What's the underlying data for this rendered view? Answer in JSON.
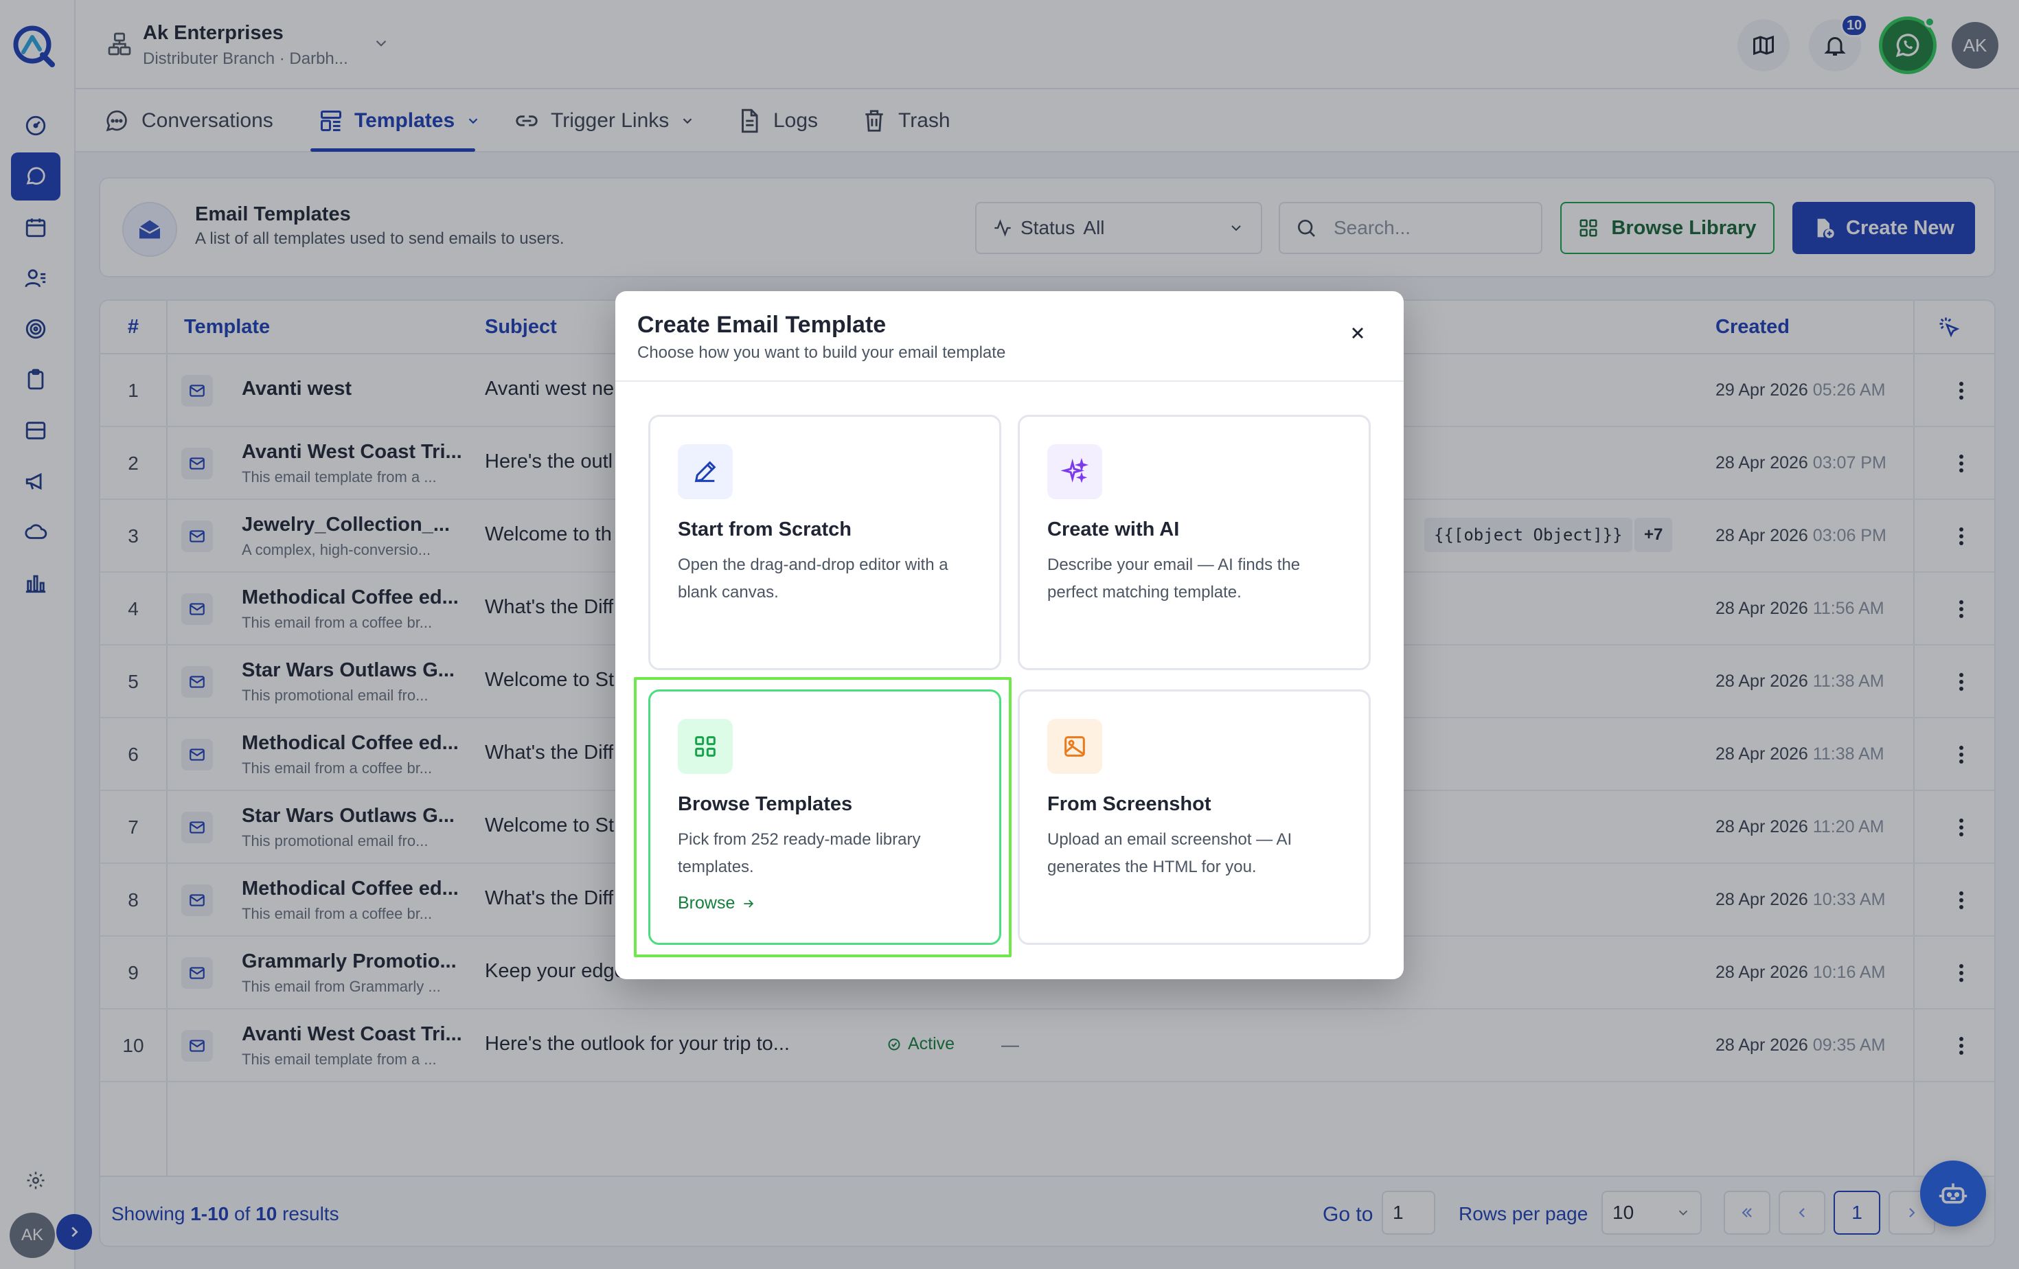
{
  "header": {
    "org_name": "Ak Enterprises",
    "org_sub": "Distributer Branch · Darbh...",
    "notif_count": "10",
    "avatar": "AK"
  },
  "sidebar": {
    "items": [
      "dashboard-icon",
      "chat-icon",
      "calendar-icon",
      "contacts-icon",
      "target-icon",
      "clipboard-icon",
      "inbox-icon",
      "megaphone-icon",
      "cloud-icon",
      "analytics-icon"
    ],
    "avatar": "AK"
  },
  "tabs": [
    {
      "label": "Conversations"
    },
    {
      "label": "Templates"
    },
    {
      "label": "Trigger Links"
    },
    {
      "label": "Logs"
    },
    {
      "label": "Trash"
    }
  ],
  "page": {
    "title": "Email Templates",
    "subtitle": "A list of all templates used to send emails to users.",
    "status_label": "Status",
    "status_value": "All",
    "search_placeholder": "Search...",
    "browse_library": "Browse Library",
    "create_new": "Create New"
  },
  "table": {
    "headers": {
      "num": "#",
      "template": "Template",
      "subject": "Subject",
      "created": "Created"
    },
    "rows": [
      {
        "num": "1",
        "name": "Avanti west",
        "desc": "",
        "subject": "Avanti west ne",
        "date": "29 Apr 2026",
        "time": "05:26 AM"
      },
      {
        "num": "2",
        "name": "Avanti West Coast Tri...",
        "desc": "This email template from a ...",
        "subject": "Here's the outl",
        "date": "28 Apr 2026",
        "time": "03:07 PM"
      },
      {
        "num": "3",
        "name": "Jewelry_Collection_...",
        "desc": "A complex, high-conversio...",
        "subject": "Welcome to th",
        "date": "28 Apr 2026",
        "time": "03:06 PM"
      },
      {
        "num": "4",
        "name": "Methodical Coffee ed...",
        "desc": "This email from a coffee br...",
        "subject": "What's the Diff",
        "date": "28 Apr 2026",
        "time": "11:56 AM"
      },
      {
        "num": "5",
        "name": "Star Wars Outlaws G...",
        "desc": "This promotional email fro...",
        "subject": "Welcome to St",
        "date": "28 Apr 2026",
        "time": "11:38 AM"
      },
      {
        "num": "6",
        "name": "Methodical Coffee ed...",
        "desc": "This email from a coffee br...",
        "subject": "What's the Diff",
        "date": "28 Apr 2026",
        "time": "11:38 AM"
      },
      {
        "num": "7",
        "name": "Star Wars Outlaws G...",
        "desc": "This promotional email fro...",
        "subject": "Welcome to St",
        "date": "28 Apr 2026",
        "time": "11:20 AM"
      },
      {
        "num": "8",
        "name": "Methodical Coffee ed...",
        "desc": "This email from a coffee br...",
        "subject": "What's the Diff",
        "date": "28 Apr 2026",
        "time": "10:33 AM"
      },
      {
        "num": "9",
        "name": "Grammarly Promotio...",
        "desc": "This email from Grammarly ...",
        "subject": "Keep your edge",
        "date": "28 Apr 2026",
        "time": "10:16 AM"
      },
      {
        "num": "10",
        "name": "Avanti West Coast Tri...",
        "desc": "This email template from a ...",
        "subject": "Here's the outlook for your trip to...",
        "date": "28 Apr 2026",
        "time": "09:35 AM",
        "status": "Active",
        "vars": "—"
      }
    ],
    "row3_var_chip": "{{[object Object]}}",
    "row3_more": "+7"
  },
  "footer": {
    "showing_prefix": "Showing",
    "showing_range": "1-10",
    "showing_of": "of",
    "showing_total": "10",
    "showing_suffix": "results",
    "goto_label": "Go to",
    "goto_value": "1",
    "rows_label": "Rows per page",
    "rows_value": "10",
    "current_page": "1"
  },
  "modal": {
    "title": "Create Email Template",
    "subtitle": "Choose how you want to build your email template",
    "options": [
      {
        "title": "Start from Scratch",
        "desc": "Open the drag-and-drop editor with a blank canvas."
      },
      {
        "title": "Create with AI",
        "desc": "Describe your email — AI finds the perfect matching template."
      },
      {
        "title": "Browse Templates",
        "desc": "Pick from 252 ready-made library templates.",
        "link": "Browse"
      },
      {
        "title": "From Screenshot",
        "desc": "Upload an email screenshot — AI generates the HTML for you."
      }
    ]
  },
  "colors": {
    "primary": "#1d3fb8",
    "success": "#16a34a",
    "highlight": "#6ee84a",
    "ai_purple": "#7c3aed",
    "screenshot_orange": "#ea7b1c"
  }
}
